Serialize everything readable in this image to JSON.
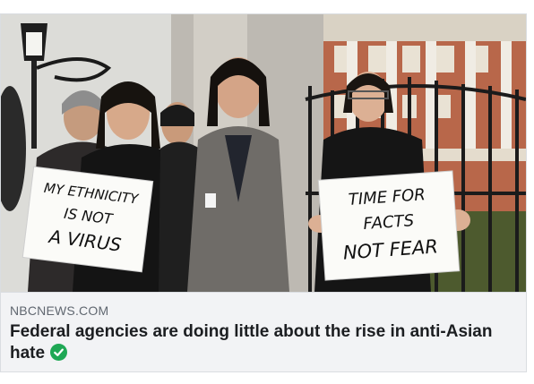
{
  "link_preview": {
    "source_domain": "NBCNEWS.COM",
    "headline": "Federal agencies are doing little about the rise in anti-Asian hate",
    "verified_icon": "check-circle-icon",
    "verified_color": "#1fa855"
  },
  "photo": {
    "sign_left": {
      "line1": "MY ETHNICITY",
      "line2": "IS NOT",
      "line3": "A VIRUS"
    },
    "sign_right": {
      "line1": "TIME FOR",
      "line2": "FACTS",
      "line3": "NOT FEAR"
    }
  },
  "colors": {
    "card_background": "#f2f3f5",
    "source_text": "#606770",
    "headline_text": "#1c1e21",
    "building_brick": "#b8674a"
  }
}
